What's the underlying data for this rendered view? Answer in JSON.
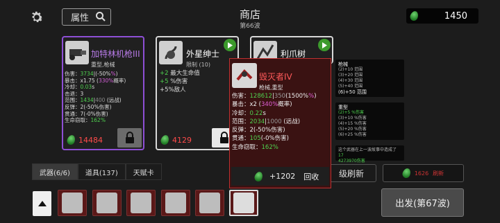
{
  "header": {
    "attr_label": "属性",
    "shop_title": "商店",
    "wave": "第66波",
    "money": "1450"
  },
  "cards": [
    {
      "name": "加特林机枪III",
      "sub": "重型,枪械",
      "stats": [
        {
          "label": "伤害：",
          "parts": [
            [
              "g",
              "3734"
            ],
            [
              "w",
              "|"
            ],
            [
              "w",
              "(-50%"
            ],
            [
              "m",
              "%"
            ],
            [
              "w",
              ")"
            ]
          ]
        },
        {
          "label": "暴击：",
          "parts": [
            [
              "w",
              "x1.75 ("
            ],
            [
              "m",
              "330%"
            ],
            [
              "w",
              "概率)"
            ]
          ]
        },
        {
          "label": "冷却：",
          "parts": [
            [
              "g",
              "0.03"
            ],
            [
              "w",
              "s"
            ]
          ]
        },
        {
          "label": "击退：",
          "parts": [
            [
              "w",
              "3"
            ]
          ]
        },
        {
          "label": "范围：",
          "parts": [
            [
              "g",
              "1434"
            ],
            [
              "w",
              "|"
            ],
            [
              "d",
              "400"
            ],
            [
              "w",
              " (远战)"
            ]
          ]
        },
        {
          "label": "反弹：",
          "parts": [
            [
              "w",
              "2(-50%伤害)"
            ]
          ]
        },
        {
          "label": "贯通：",
          "parts": [
            [
              "w",
              "7(-0%伤害)"
            ]
          ]
        },
        {
          "label": "生命窃取：",
          "parts": [
            [
              "g",
              "162%"
            ]
          ]
        }
      ],
      "price": "14484",
      "name_color": "#b87be8"
    },
    {
      "name": "外星绅士",
      "sub": "限制 (10)",
      "stats": [
        {
          "label": "",
          "parts": [
            [
              "g",
              "+2"
            ],
            [
              "w",
              " 最大生命值"
            ]
          ]
        },
        {
          "label": "",
          "parts": [
            [
              "g",
              "+5"
            ],
            [
              "w",
              " %伤害"
            ]
          ]
        },
        {
          "label": "",
          "parts": [
            [
              "w",
              "+5%敌人"
            ]
          ]
        }
      ],
      "price": "4129",
      "name_color": "#ffffff"
    },
    {
      "name": "利爪树",
      "name_color": "#ffffff"
    }
  ],
  "side_panels": [
    {
      "title": "枪械",
      "lines": [
        "(2)+10 范围",
        "(3)+20 范围",
        "(4)+30 范围",
        "(5)+40 范围"
      ],
      "highlight": "(6)+50 范围"
    },
    {
      "title": "重型",
      "highlight": "(2)+5 %伤害",
      "lines": [
        "(3)+10 %伤害",
        "(4)+15 %伤害",
        "(5)+20 %伤害",
        "(6)+25 %伤害"
      ]
    },
    {
      "text": "这个武器在上一波故事中造成了",
      "value": "17",
      "value2": "4273970伤害"
    }
  ],
  "popup": {
    "name": "毁灭者IV",
    "sub": "枪械,重型",
    "recycle_value": "+1202",
    "recycle_label": "回收",
    "lines": [
      {
        "label": "伤害：",
        "parts": [
          [
            "g",
            "128612"
          ],
          [
            "w",
            "|"
          ],
          [
            "d",
            "350"
          ],
          [
            "w",
            "(1500%"
          ],
          [
            "m",
            "%"
          ],
          [
            "w",
            ")"
          ]
        ]
      },
      {
        "label": "暴击：",
        "parts": [
          [
            "w",
            "x2 ("
          ],
          [
            "m",
            "340%"
          ],
          [
            "w",
            "概率)"
          ]
        ]
      },
      {
        "label": "冷却：",
        "parts": [
          [
            "g",
            "0.22"
          ],
          [
            "w",
            "s"
          ]
        ]
      },
      {
        "label": "范围：",
        "parts": [
          [
            "g",
            "2034"
          ],
          [
            "w",
            "|"
          ],
          [
            "d",
            "1000"
          ],
          [
            "w",
            " (远战)"
          ]
        ]
      },
      {
        "label": "反弹：",
        "parts": [
          [
            "w",
            "2(-50%伤害)"
          ]
        ]
      },
      {
        "label": "贯通：",
        "parts": [
          [
            "g",
            "105"
          ],
          [
            "w",
            "(-0%伤害)"
          ]
        ]
      },
      {
        "label": "生命窃取：",
        "parts": [
          [
            "g",
            "162%"
          ]
        ]
      }
    ]
  },
  "tabs": [
    {
      "label": "武器(6/6)",
      "active": true
    },
    {
      "label": "道具(137)",
      "active": false
    },
    {
      "label": "天赋卡",
      "active": false
    }
  ],
  "buttons": {
    "refresh": "级刷新",
    "refresh2_value": "1626",
    "refresh2_label": "刷新",
    "go": "出发(第67波)"
  },
  "weapon_slots": [
    "megaphone",
    "gatling",
    "gatling",
    "gatling",
    "gatling",
    "destroyer"
  ],
  "colors": {
    "accent_purple": "#8e4fd6",
    "green": "#4fd14f",
    "red": "#c03030",
    "magenta": "#d35ed8"
  }
}
